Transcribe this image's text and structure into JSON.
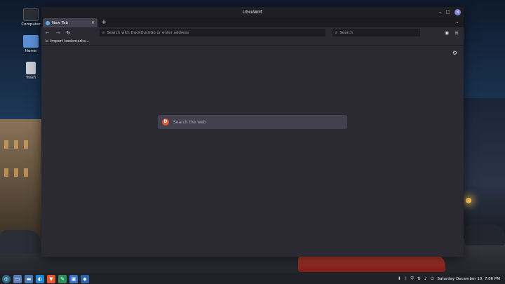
{
  "desktop": {
    "icons": [
      {
        "label": "Computer"
      },
      {
        "label": "Home"
      },
      {
        "label": "Trash"
      }
    ]
  },
  "window": {
    "title": "LibreWolf",
    "controls": {
      "minimize": "–",
      "maximize": "▢",
      "close": "✕"
    }
  },
  "tabs": {
    "items": [
      {
        "label": "New Tab",
        "close": "✕"
      }
    ],
    "new_tab": "+",
    "list_all": "⌄"
  },
  "navbar": {
    "back": "←",
    "forward": "→",
    "reload": "↻",
    "url_placeholder": "Search with DuckDuckGo or enter address",
    "search_placeholder": "Search",
    "extensions_icon": "◉",
    "menu_icon": "≡"
  },
  "bookmarks": {
    "import_label": "Import bookmarks..."
  },
  "content": {
    "web_search_placeholder": "Search the web",
    "settings_icon": "⚙"
  },
  "taskbar": {
    "clock": "Saturday December 10, 7:06 PM"
  },
  "colors": {
    "window_bg": "#2b2a33",
    "titlebar_bg": "#1f1e25",
    "tab_active": "#42414d",
    "duckduckgo": "#de5833",
    "close_button": "#7c84d6"
  }
}
